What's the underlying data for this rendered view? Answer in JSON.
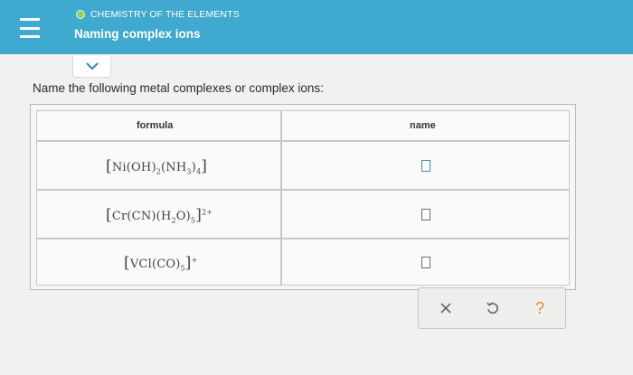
{
  "header": {
    "topic": "CHEMISTRY OF THE ELEMENTS",
    "title": "Naming complex ions"
  },
  "question": {
    "prompt": "Name the following metal complexes or complex ions:"
  },
  "table": {
    "headers": {
      "formula": "formula",
      "name": "name"
    },
    "rows": [
      {
        "formula_parts": {
          "open": "[",
          "metal": "Ni",
          "lig1": "(OH)",
          "n1": "2",
          "lig2": "(NH",
          "lig2sub": "3",
          "lig2close": ")",
          "n2": "4",
          "close": "]"
        },
        "name_value": ""
      },
      {
        "formula_parts": {
          "open": "[",
          "metal": "Cr",
          "lig1": "(CN)",
          "lig2": "(H",
          "lig2sub": "2",
          "lig2close": "O)",
          "n2": "5",
          "close": "]",
          "charge": "2+"
        },
        "name_value": ""
      },
      {
        "formula_parts": {
          "open": "[",
          "metal": "VCl",
          "lig1": "(CO)",
          "n1": "5",
          "close": "]",
          "charge": "+"
        },
        "name_value": ""
      }
    ]
  },
  "actions": {
    "clear_icon": "x-icon",
    "undo_icon": "undo-icon",
    "help_icon": "question-mark-icon",
    "help_symbol": "?"
  },
  "colors": {
    "header_bg": "#3fa9cf",
    "topic_dot": "#8bd55b",
    "accent": "#3d86b3",
    "help": "#e8873a"
  }
}
